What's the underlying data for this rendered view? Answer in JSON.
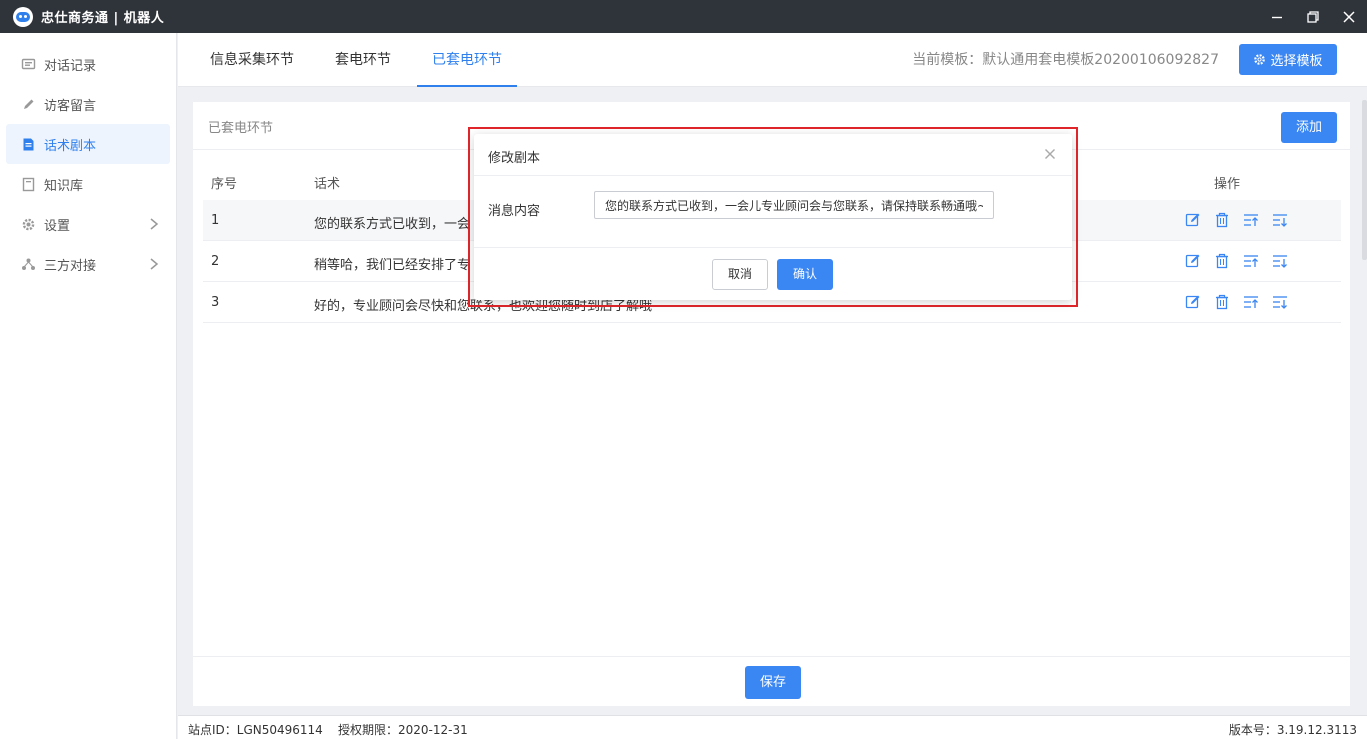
{
  "app": {
    "title": "忠仕商务通 | 机器人"
  },
  "sidebar": {
    "items": [
      {
        "label": "对话记录",
        "icon": "chat-record-icon"
      },
      {
        "label": "访客留言",
        "icon": "pencil-icon"
      },
      {
        "label": "话术剧本",
        "icon": "script-icon",
        "active": true
      },
      {
        "label": "知识库",
        "icon": "book-icon"
      },
      {
        "label": "设置",
        "icon": "gear-icon",
        "has_children": true
      },
      {
        "label": "三方对接",
        "icon": "connect-icon",
        "has_children": true
      }
    ]
  },
  "tabs": [
    {
      "label": "信息采集环节"
    },
    {
      "label": "套电环节"
    },
    {
      "label": "已套电环节",
      "active": true
    }
  ],
  "header": {
    "template_info": "当前模板：默认通用套电模板20200106092827",
    "choose_template_label": "选择模板"
  },
  "card": {
    "title": "已套电环节",
    "add_label": "添加",
    "save_label": "保存",
    "columns": {
      "no": "序号",
      "text": "话术",
      "ops": "操作"
    },
    "rows": [
      {
        "no": "1",
        "text": "您的联系方式已收到，一会"
      },
      {
        "no": "2",
        "text": "稍等哈，我们已经安排了专"
      },
      {
        "no": "3",
        "text": "好的，专业顾问会尽快和您联系，也欢迎您随时到店了解哦~"
      }
    ]
  },
  "modal": {
    "title": "修改剧本",
    "field_label": "消息内容",
    "field_value": "您的联系方式已收到，一会儿专业顾问会与您联系，请保持联系畅通哦~",
    "cancel_label": "取消",
    "ok_label": "确认"
  },
  "status": {
    "site_id": "站点ID：LGN50496114",
    "license": "授权期限：2020-12-31",
    "version": "版本号：3.19.12.3113"
  },
  "colors": {
    "accent": "#3a86f2",
    "highlight_border": "#e0262b",
    "titlebar": "#2f333a"
  }
}
